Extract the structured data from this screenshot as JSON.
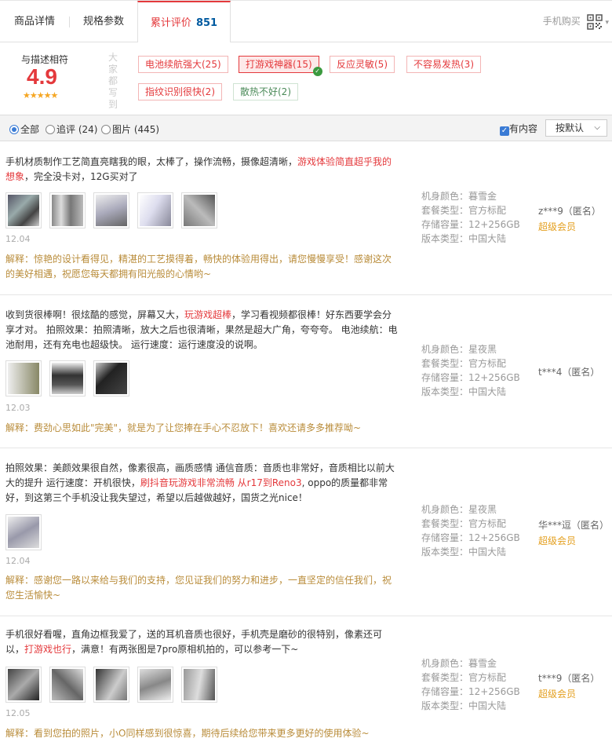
{
  "tabs": [
    {
      "label": "商品详情"
    },
    {
      "label": "规格参数"
    },
    {
      "label": "累计评价",
      "count": "851"
    }
  ],
  "mobile_buy": "手机购买",
  "summary": {
    "rate_label": "与描述相符",
    "rate_value": "4.9",
    "stars": "★★★★★",
    "all_say": "大家都写到",
    "tags": [
      "电池续航强大(25)",
      "打游戏神器(15)",
      "反应灵敏(5)",
      "不容易发热(3)",
      "指纹识别很快(2)",
      "散热不好(2)"
    ]
  },
  "filters": {
    "all": "全部",
    "followup": "追评 (24)",
    "images": "图片 (445)",
    "has_content": "有内容",
    "sort": "按默认"
  },
  "colors": {
    "accent": "#e4393c",
    "reply": "#b98c3a",
    "vip": "#e4a020",
    "link": "#005aa0"
  },
  "reviews": [
    {
      "text_a": "手机材质制作工艺简直亮瞎我的眼，太棒了，操作流畅，摄像超清晰，",
      "hl": "游戏体验简直超乎我的想象",
      "text_b": "，完全没卡对，12G买对了",
      "date": "12.04",
      "reply": "解释：惊艳的设计看得见，精湛的工艺摸得着，畅快的体验用得出，请您慢慢享受！感谢这次的美好相遇，祝愿您每天都拥有阳光般的心情哟~",
      "color": "机身颜色：暮雪金",
      "package": "套餐类型：官方标配",
      "storage": "存储容量：12+256GB",
      "version": "版本类型：中国大陆",
      "user": "z***9（匿名）",
      "vip": "超级会员"
    },
    {
      "text_a": "收到货很棒啊！很炫酷的感觉，屏幕又大，",
      "hl": "玩游戏超棒",
      "text_b": "，学习看视频都很棒！好东西要学会分享才对。 拍照效果：拍照清晰，放大之后也很清晰，果然是超大广角，夸夸夸。 电池续航：电池耐用，还有充电也超级快。 运行速度：运行速度没的说啊。",
      "date": "12.03",
      "reply": "解释：费劲心思如此\"完美\"，就是为了让您捧在手心不忍放下！喜欢还请多多推荐呦~",
      "color": "机身颜色：星夜黑",
      "package": "套餐类型：官方标配",
      "storage": "存储容量：12+256GB",
      "version": "版本类型：中国大陆",
      "user": "t***4（匿名）",
      "vip": ""
    },
    {
      "text_a": "拍照效果：美颜效果很自然，像素很高，画质感情 通信音质：音质也非常好，音质相比以前大大的提升 运行速度：开机很快，",
      "hl": "刷抖音玩游戏非常流畅 从r17到Reno3",
      "text_b": ", oppo的质量都非常好，到这第三个手机没让我失望过，希望以后越做越好，国货之光nice！",
      "date": "12.04",
      "reply": "解释：感谢您一路以来给与我们的支持，您见证我们的努力和进步，一直坚定的信任我们，祝您生活愉快~",
      "color": "机身颜色：星夜黑",
      "package": "套餐类型：官方标配",
      "storage": "存储容量：12+256GB",
      "version": "版本类型：中国大陆",
      "user": "华***逗（匿名）",
      "vip": "超级会员"
    },
    {
      "text_a": "手机很好看喔，直角边框我爱了，送的耳机音质也很好，手机壳是磨砂的很特别，像素还可以，",
      "hl": "打游戏也行",
      "text_b": "，满意！有两张图是7pro原相机拍的，可以参考一下~",
      "date": "12.05",
      "reply": "解释：看到您拍的照片，小O同样感到很惊喜，期待后续给您带来更多更好的使用体验~",
      "color": "机身颜色：暮雪金",
      "package": "套餐类型：官方标配",
      "storage": "存储容量：12+256GB",
      "version": "版本类型：中国大陆",
      "user": "t***9（匿名）",
      "vip": "超级会员"
    }
  ]
}
